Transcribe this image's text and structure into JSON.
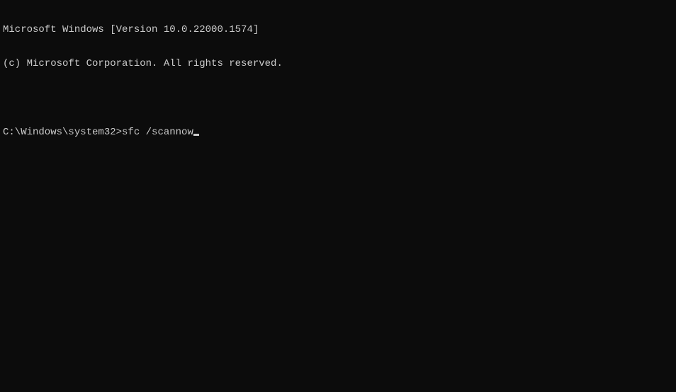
{
  "header": {
    "version_line": "Microsoft Windows [Version 10.0.22000.1574]",
    "copyright_line": "(c) Microsoft Corporation. All rights reserved."
  },
  "prompt": {
    "path": "C:\\Windows\\system32>",
    "command": "sfc /scannow"
  }
}
